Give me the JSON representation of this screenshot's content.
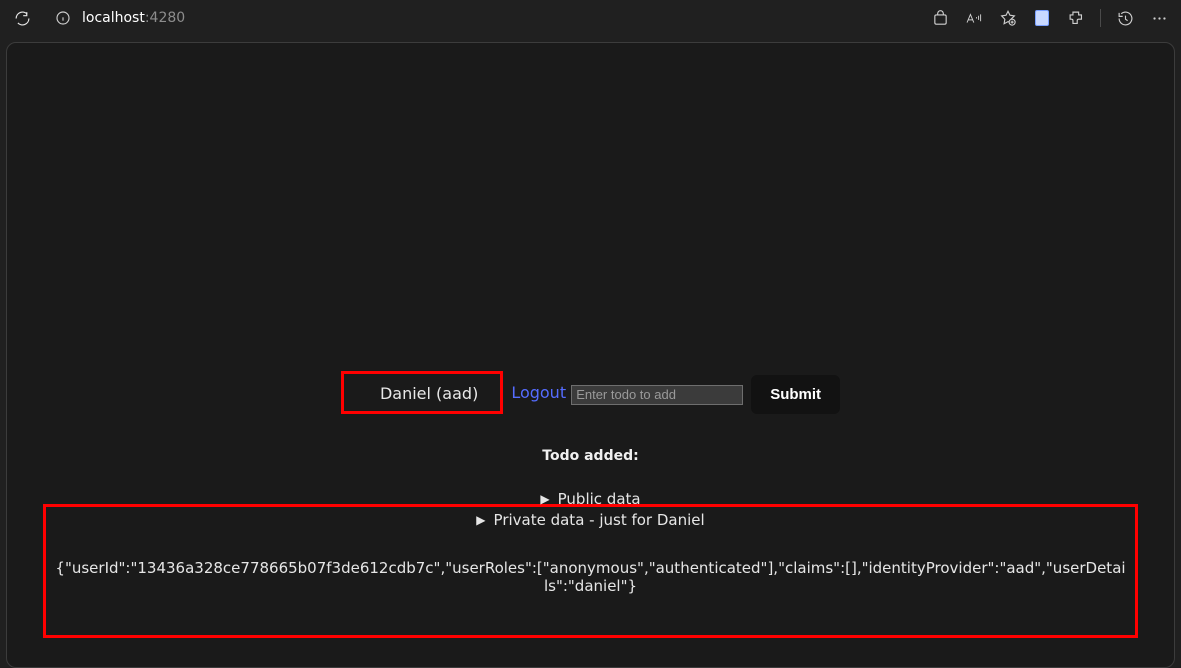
{
  "browser": {
    "url_host": "localhost",
    "url_port": ":4280"
  },
  "page": {
    "user_display": "Daniel (aad)",
    "logout_label": "Logout",
    "todo_placeholder": "Enter todo to add",
    "submit_label": "Submit",
    "added_label": "Todo added:",
    "public_label": "Public data",
    "private_label": "Private data - just for Daniel",
    "principal_json": "{\"userId\":\"13436a328ce778665b07f3de612cdb7c\",\"userRoles\":[\"anonymous\",\"authenticated\"],\"claims\":[],\"identityProvider\":\"aad\",\"userDetails\":\"daniel\"}"
  }
}
